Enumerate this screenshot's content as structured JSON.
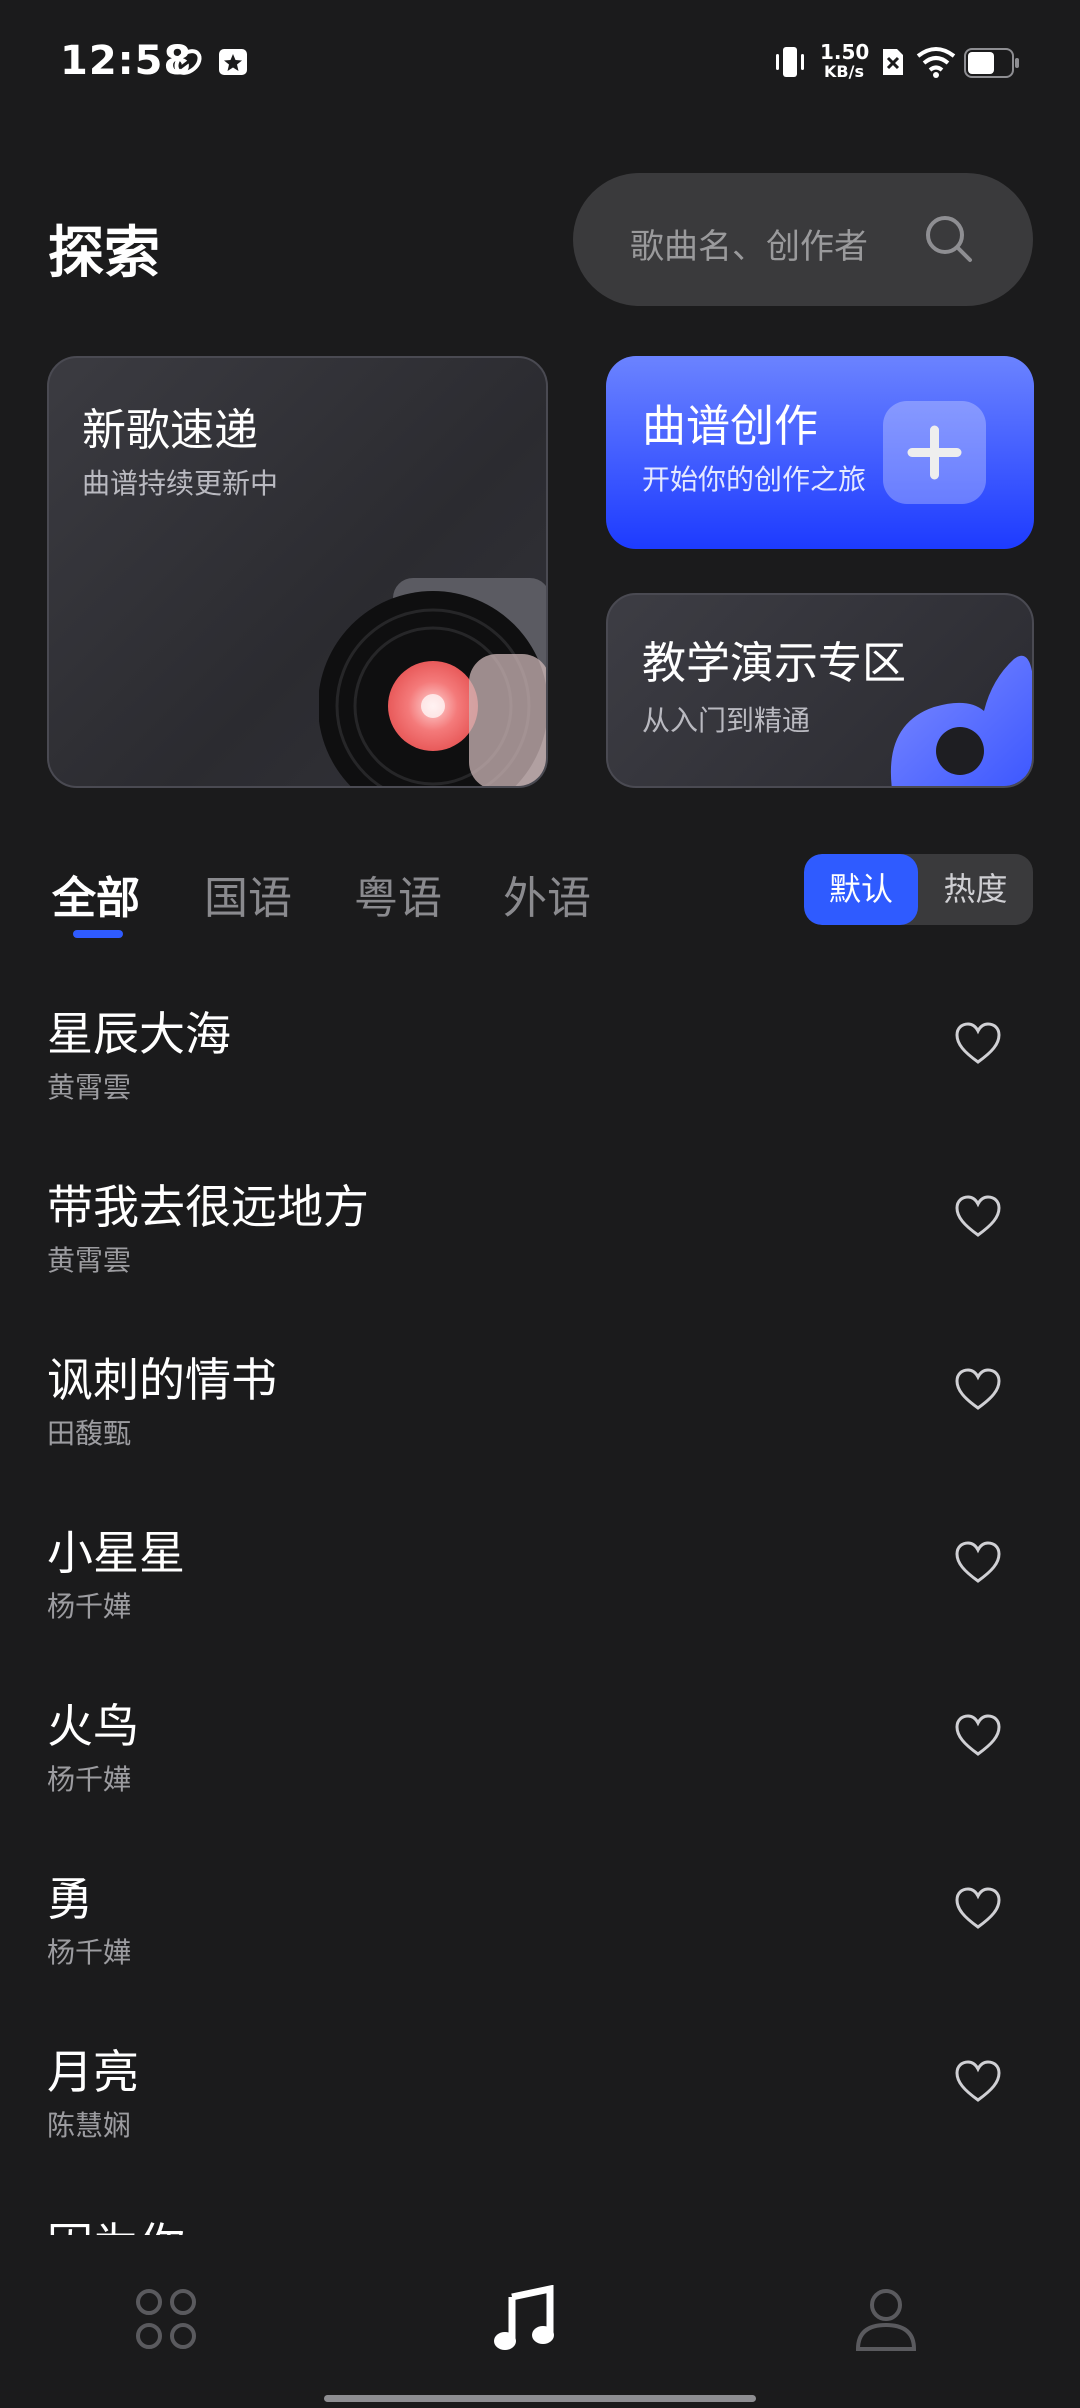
{
  "status_bar": {
    "time": "12:58",
    "net_speed_value": "1.50",
    "net_speed_unit": "KB/s",
    "icons": [
      "swirl-icon",
      "star-badge-icon",
      "vibrate-icon",
      "sim-off-icon",
      "wifi-icon",
      "battery-icon"
    ]
  },
  "header": {
    "title": "探索",
    "search_placeholder": "歌曲名、创作者"
  },
  "cards": {
    "new_songs": {
      "title": "新歌速递",
      "subtitle": "曲谱持续更新中"
    },
    "compose": {
      "title": "曲谱创作",
      "subtitle": "开始你的创作之旅"
    },
    "teaching": {
      "title": "教学演示专区",
      "subtitle": "从入门到精通"
    }
  },
  "tabs": [
    {
      "label": "全部",
      "active": true
    },
    {
      "label": "国语",
      "active": false
    },
    {
      "label": "粤语",
      "active": false
    },
    {
      "label": "外语",
      "active": false
    }
  ],
  "sort": {
    "default_label": "默认",
    "hot_label": "热度",
    "selected": "默认"
  },
  "songs": [
    {
      "title": "星辰大海",
      "artist": "黄霄雲"
    },
    {
      "title": "带我去很远地方",
      "artist": "黄霄雲"
    },
    {
      "title": "讽刺的情书",
      "artist": "田馥甄"
    },
    {
      "title": "小星星",
      "artist": "杨千嬅"
    },
    {
      "title": "火鸟",
      "artist": "杨千嬅"
    },
    {
      "title": "勇",
      "artist": "杨千嬅"
    },
    {
      "title": "月亮",
      "artist": "陈慧娴"
    },
    {
      "title": "因为你",
      "artist": ""
    }
  ],
  "bottom_nav": [
    {
      "name": "home-grid-icon",
      "active": false
    },
    {
      "name": "music-note-icon",
      "active": true
    },
    {
      "name": "profile-icon",
      "active": false
    }
  ],
  "colors": {
    "accent": "#2f5bff",
    "background": "#1b1b1c"
  }
}
